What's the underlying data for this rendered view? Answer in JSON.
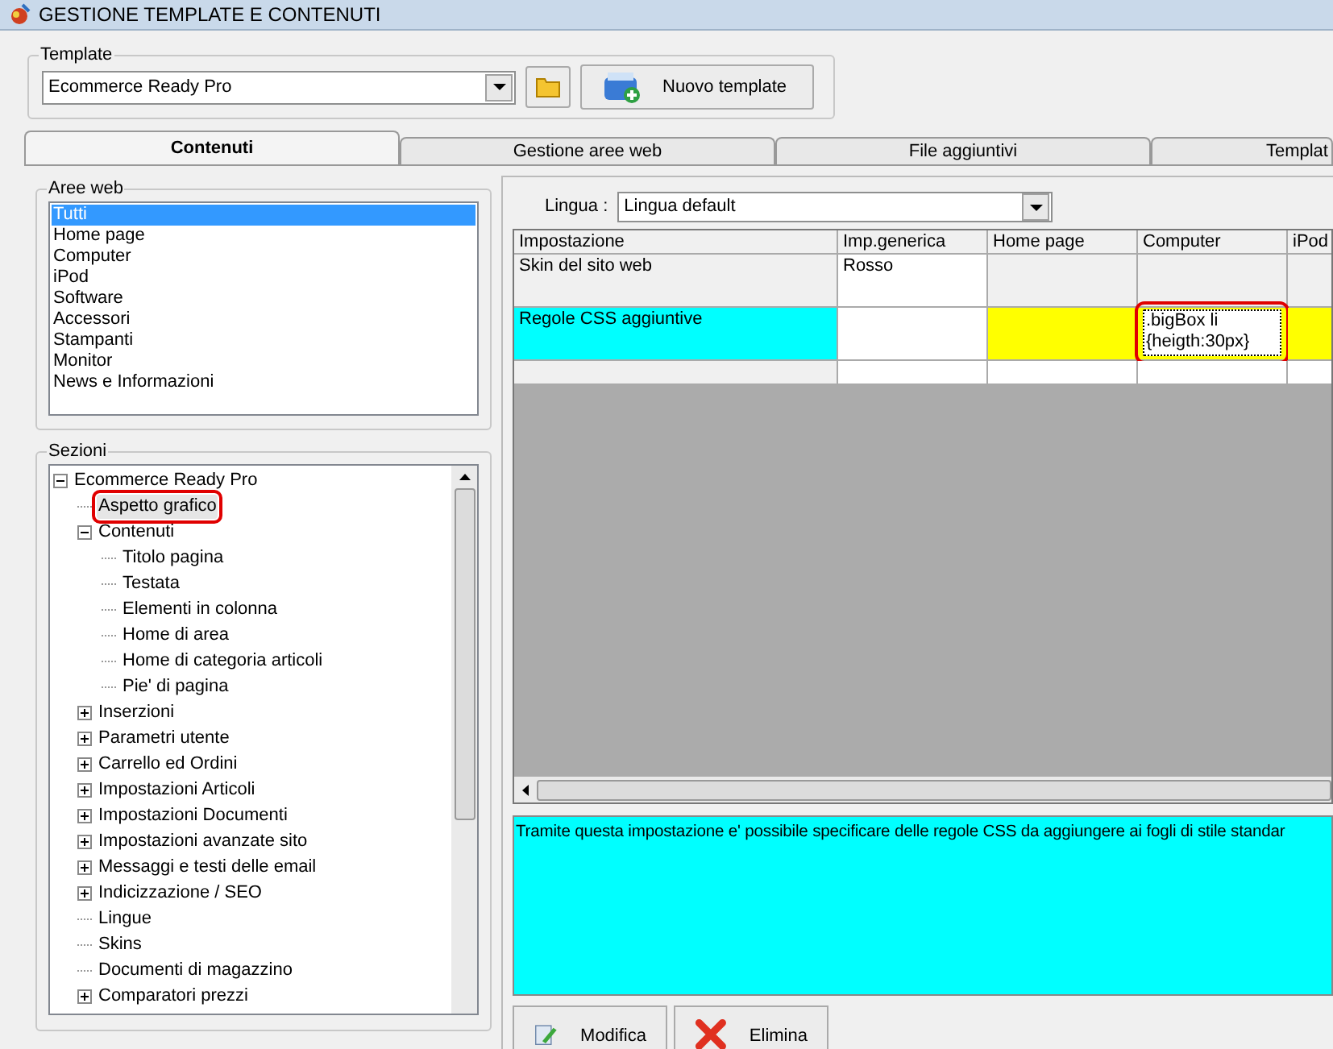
{
  "window": {
    "title": "GESTIONE TEMPLATE E CONTENUTI"
  },
  "template": {
    "label": "Template",
    "value": "Ecommerce Ready Pro",
    "new_button": "Nuovo template"
  },
  "tabs": [
    {
      "label": "Contenuti",
      "selected": true
    },
    {
      "label": "Gestione aree web",
      "selected": false
    },
    {
      "label": "File aggiuntivi",
      "selected": false
    },
    {
      "label": "Templat",
      "selected": false
    }
  ],
  "aree_web": {
    "label": "Aree web",
    "items": [
      {
        "label": "Tutti",
        "selected": true
      },
      {
        "label": "Home page",
        "selected": false
      },
      {
        "label": "Computer",
        "selected": false
      },
      {
        "label": "iPod",
        "selected": false
      },
      {
        "label": "Software",
        "selected": false
      },
      {
        "label": "Accessori",
        "selected": false
      },
      {
        "label": "Stampanti",
        "selected": false
      },
      {
        "label": "Monitor",
        "selected": false
      },
      {
        "label": "News e Informazioni",
        "selected": false
      }
    ]
  },
  "sezioni": {
    "label": "Sezioni",
    "tree": [
      {
        "label": "Ecommerce Ready Pro",
        "expanded": true,
        "children": [
          {
            "label": "Aspetto grafico",
            "selected": true
          },
          {
            "label": "Contenuti",
            "expanded": true,
            "children": [
              {
                "label": "Titolo pagina"
              },
              {
                "label": "Testata"
              },
              {
                "label": "Elementi in colonna"
              },
              {
                "label": "Home di area"
              },
              {
                "label": "Home di categoria articoli"
              },
              {
                "label": "Pie' di pagina"
              }
            ]
          },
          {
            "label": "Inserzioni",
            "expanded": false
          },
          {
            "label": "Parametri utente",
            "expanded": false
          },
          {
            "label": "Carrello ed Ordini",
            "expanded": false
          },
          {
            "label": "Impostazioni Articoli",
            "expanded": false
          },
          {
            "label": "Impostazioni Documenti",
            "expanded": false
          },
          {
            "label": "Impostazioni avanzate sito",
            "expanded": false
          },
          {
            "label": "Messaggi e testi delle email",
            "expanded": false
          },
          {
            "label": "Indicizzazione / SEO",
            "expanded": false
          },
          {
            "label": "Lingue"
          },
          {
            "label": "Skins"
          },
          {
            "label": "Documenti di magazzino"
          },
          {
            "label": "Comparatori prezzi",
            "expanded": false
          }
        ]
      }
    ]
  },
  "lingua": {
    "label": "Lingua :",
    "value": "Lingua default"
  },
  "table": {
    "columns": [
      "Impostazione",
      "Imp.generica",
      "Home page",
      "Computer",
      "iPod"
    ],
    "rows": [
      {
        "selected": false,
        "cells": [
          {
            "text": "Skin del sito web",
            "highlighted": false
          },
          {
            "text": "Rosso",
            "highlighted": false
          },
          {
            "highlighted": false
          },
          {
            "highlighted": false
          },
          {
            "highlighted": false
          }
        ]
      },
      {
        "selected": true,
        "cells": [
          {
            "text": "Regole CSS aggiuntive",
            "highlighted": false
          },
          {
            "highlighted": false
          },
          {
            "highlighted": true
          },
          {
            "text": ".bigBox li {heigth:30px}",
            "highlighted": true,
            "editing": true
          },
          {
            "highlighted": true
          }
        ]
      }
    ]
  },
  "description": "Tramite questa impostazione e' possibile specificare delle regole CSS da aggiungere ai fogli di stile standar",
  "buttons": [
    "Modifica",
    "Elimina"
  ]
}
